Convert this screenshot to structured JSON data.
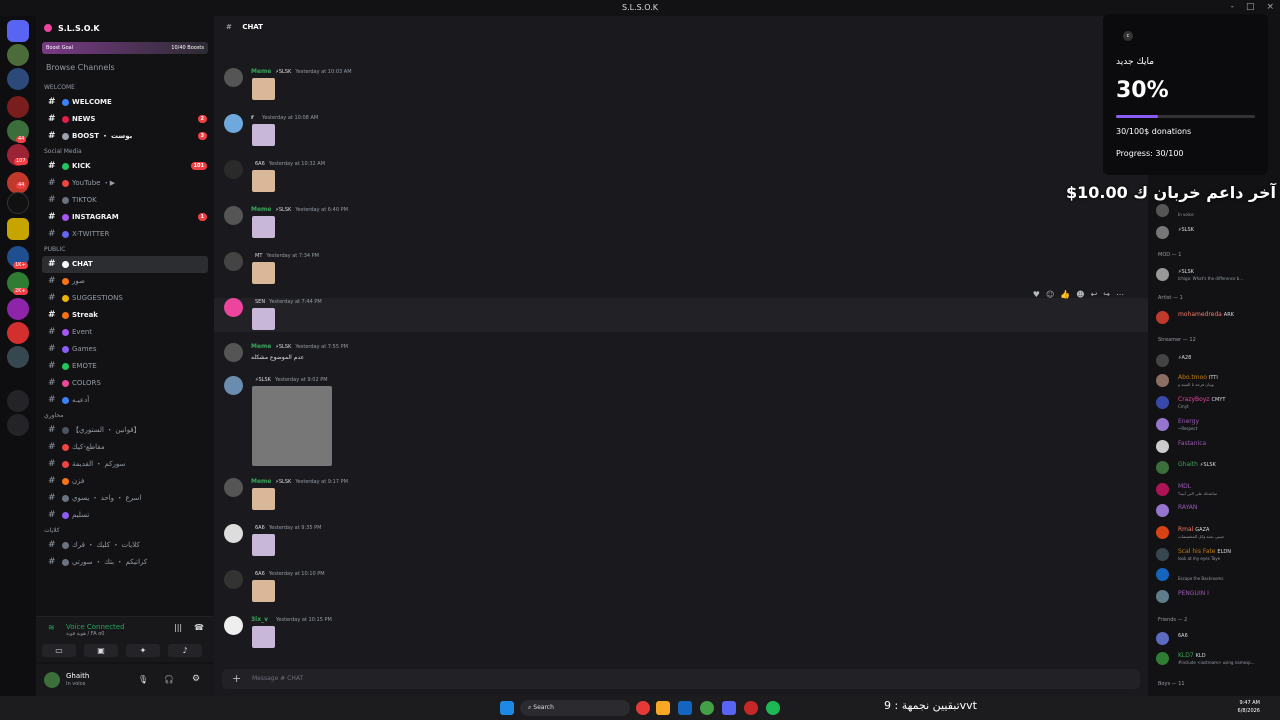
{
  "window": {
    "title": "S.L.S.O.K",
    "controls": [
      "-",
      "□",
      "×"
    ]
  },
  "server": {
    "name": "S.L.S.O.K",
    "boost_goal": "Boost Goal",
    "boost_count": "10/40 Boosts",
    "browse": "Browse Channels"
  },
  "guild_badges": [
    "44",
    "107",
    "44",
    "1K+",
    "2K+"
  ],
  "categories": {
    "welcome": "WELCOME",
    "social": "Social Media",
    "public": "PUBLIC",
    "ma7jouri": "محاوري",
    "kalat": "كلايات"
  },
  "channels": [
    {
      "label": "WELCOME",
      "dot": "#3b82f6",
      "unread": true
    },
    {
      "label": "NEWS",
      "dot": "#e11d48",
      "unread": true,
      "count": "2"
    },
    {
      "label": "BOOST ・ بوست",
      "dot": "#9ca3af",
      "unread": true,
      "count": "3"
    },
    {
      "label": "KICK",
      "dot": "#22c55e",
      "unread": true,
      "count": "101"
    },
    {
      "label": "YouTube ・▶",
      "dot": "#ef4444",
      "unread": false
    },
    {
      "label": "TIKTOK",
      "dot": "#6b7280",
      "unread": false
    },
    {
      "label": "INSTAGRAM",
      "dot": "#a855f7",
      "unread": true,
      "count": "1"
    },
    {
      "label": "X-TWITTER",
      "dot": "#6366f1",
      "unread": false
    },
    {
      "label": "CHAT",
      "dot": "#ffffff",
      "unread": true,
      "active": true
    },
    {
      "label": "صور",
      "dot": "#f97316",
      "unread": false
    },
    {
      "label": "SUGGESTIONS",
      "dot": "#eab308",
      "unread": false
    },
    {
      "label": "Streak",
      "dot": "#f97316",
      "unread": true
    },
    {
      "label": "Event",
      "dot": "#a855f7",
      "unread": false
    },
    {
      "label": "Games",
      "dot": "#8b5cf6",
      "unread": false
    },
    {
      "label": "EMOTE",
      "dot": "#22c55e",
      "unread": false
    },
    {
      "label": "COLORS",
      "dot": "#ec4899",
      "unread": false
    },
    {
      "label": "أدعيـه",
      "dot": "#3b82f6",
      "unread": false
    },
    {
      "label": "【قوانين ・ الستوري】",
      "dot": "#4b5563",
      "unread": false
    },
    {
      "label": "مقاطع-كيك",
      "dot": "#ef4444",
      "unread": false
    },
    {
      "label": "سوركم ・ القديمة",
      "dot": "#ef4444",
      "unread": false
    },
    {
      "label": "فزن",
      "dot": "#f97316",
      "unread": false
    },
    {
      "label": "اسرع ・ واحد ・ يسوي",
      "dot": "#6b7280",
      "unread": false
    },
    {
      "label": "تسليم",
      "dot": "#8b5cf6",
      "unread": false
    },
    {
      "label": "كلايات ・ كليك ・ قرك",
      "dot": "#6b7280",
      "unread": false
    },
    {
      "label": "كراتيكم ・ بتك ・ سورتي",
      "dot": "#6b7280",
      "unread": false
    }
  ],
  "voice": {
    "title": "Voice Connected",
    "sub": "هوية قوية / FA o0"
  },
  "user": {
    "name": "Ghaith",
    "status": "In voice"
  },
  "chat": {
    "title": "CHAT",
    "composer": "Message # CHAT"
  },
  "messages": [
    {
      "author": "Meme",
      "color": "#3ba55c",
      "tag": "⚡SLSK",
      "time": "Yesterday at 10:03 AM",
      "av": "#555"
    },
    {
      "author": "r",
      "color": "#dbdee1",
      "tag": "",
      "time": "Yesterday at 10:08 AM",
      "av": "#6fa8dc"
    },
    {
      "author": "",
      "color": "#dbdee1",
      "tag": "6A6",
      "time": "Yesterday at 10:32 AM",
      "av": "#2a2a2a"
    },
    {
      "author": "Meme",
      "color": "#3ba55c",
      "tag": "⚡SLSK",
      "time": "Yesterday at 6:40 PM",
      "av": "#555"
    },
    {
      "author": "",
      "color": "#dbdee1",
      "tag": "MT",
      "time": "Yesterday at 7:34 PM",
      "av": "#444"
    },
    {
      "author": "",
      "color": "#dbdee1",
      "tag": "SEN",
      "time": "Yesterday at 7:44 PM",
      "av": "#eb459e"
    },
    {
      "author": "Meme",
      "color": "#3ba55c",
      "tag": "⚡SLSK",
      "time": "Yesterday at 7:55 PM",
      "av": "#555",
      "text": "عدم الموضوع مشكله"
    },
    {
      "author": "",
      "color": "#dbdee1",
      "tag": "⚡SLSK",
      "time": "Yesterday at 9:02 PM",
      "av": "#6a8caf"
    },
    {
      "author": "Meme",
      "color": "#3ba55c",
      "tag": "⚡SLSK",
      "time": "Yesterday at 9:17 PM",
      "av": "#555"
    },
    {
      "author": "",
      "color": "#dbdee1",
      "tag": "6A6",
      "time": "Yesterday at 9:35 PM",
      "av": "#ddd"
    },
    {
      "author": "",
      "color": "#dbdee1",
      "tag": "6A6",
      "time": "Yesterday at 10:10 PM",
      "av": "#333"
    },
    {
      "author": "3ix_v",
      "color": "#3ba55c",
      "tag": "",
      "time": "Yesterday at 10:15 PM",
      "av": "#eee"
    }
  ],
  "members": {
    "mod": "MOD — 1",
    "artist": "Artist — 1",
    "streamer": "Streamer — 12",
    "friends": "Friends — 2",
    "boys": "Boys — 11",
    "list": [
      {
        "name": "",
        "status": "In voice",
        "color": "#dbdee1"
      },
      {
        "name": "",
        "status": "",
        "color": "#dbdee1",
        "tag": "⚡SLSK"
      },
      {
        "name": "",
        "status": "Ichigo: What's the difference b...",
        "color": "#dbdee1",
        "tag": "⚡SLSK"
      },
      {
        "name": "mohamedreda",
        "status": "",
        "color": "#f47b67",
        "tag": "ARK"
      },
      {
        "name": "",
        "status": "",
        "color": "#dbdee1",
        "tag": "⚡A28"
      },
      {
        "name": "Abo.tmoo",
        "status": "ويبان فرجة تا المبنة و",
        "color": "#c27c0e",
        "tag": "ITTI"
      },
      {
        "name": "CrazyBoyz",
        "status": "Cmyt",
        "color": "#eb459e",
        "tag": "CMYT"
      },
      {
        "name": "Energy",
        "status": "~Respect",
        "color": "#9b59b6"
      },
      {
        "name": "Fastanica",
        "status": "",
        "color": "#9b59b6"
      },
      {
        "name": "Ghaith",
        "status": "",
        "color": "#3ba55c",
        "tag": "⚡SLSK"
      },
      {
        "name": "MDL",
        "status": "ساعدتك على التي أبيه؟",
        "color": "#9b59b6"
      },
      {
        "name": "RAYAN",
        "status": "",
        "color": "#9b59b6"
      },
      {
        "name": "Rmal",
        "status": "حبيبي بحبه وكل المخصصات",
        "color": "#f47b67",
        "tag": "GAZA"
      },
      {
        "name": "Scal his Fate",
        "status": "look at my eyes Taye",
        "color": "#c27c0e",
        "tag": "ELDN"
      },
      {
        "name": "",
        "status": "Escape the Backrooms",
        "color": "#3ba55c"
      },
      {
        "name": "PENGUIN I",
        "status": "",
        "color": "#9b59b6"
      },
      {
        "name": "",
        "status": "",
        "color": "#dbdee1",
        "tag": "6A6"
      },
      {
        "name": "KLD7",
        "status": "#include <iostream> using namesp...",
        "color": "#3ba55c",
        "tag": "KLD"
      }
    ]
  },
  "overlay": {
    "logo": "c",
    "title": "مايك جديد",
    "percent": "30%",
    "progress": 0.3,
    "donations": "30/100$ donations",
    "progress_text": "Progress: 30/100"
  },
  "last_donation": "$10.00 آخر داعم خربان ك",
  "taskbar": {
    "search": "Search",
    "marquee": "تبقيين نجمهة : 9vvt",
    "time": "9:47 AM",
    "date": "6/8/2026"
  }
}
